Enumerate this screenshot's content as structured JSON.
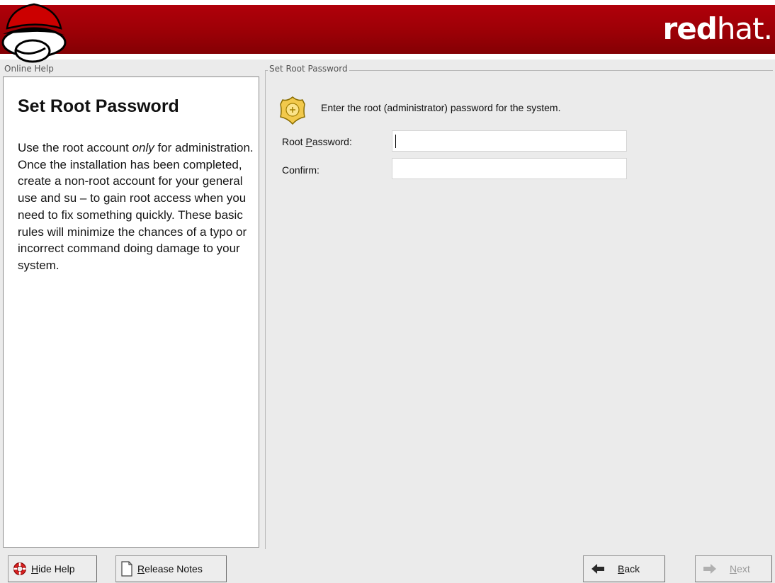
{
  "brand": {
    "bold": "red",
    "light": "hat."
  },
  "help": {
    "frame_label": "Online Help",
    "title": "Set Root Password",
    "body_before": "Use the root account ",
    "body_emph": "only",
    "body_after": " for administration. Once the installation has been completed, create a non-root account for your general use and su  – to gain root access when you need to fix something quickly. These basic rules will minimize the chances of a typo or incorrect command doing damage to your system."
  },
  "main": {
    "frame_label": "Set Root Password",
    "intro": "Enter the root (administrator) password for the system.",
    "root_password_label": "Root Password:",
    "confirm_label": "Confirm:",
    "root_password_value": "",
    "confirm_value": ""
  },
  "buttons": {
    "hide_help": "Hide Help",
    "release_notes": "Release Notes",
    "back": "Back",
    "next": "Next"
  },
  "colors": {
    "banner_red": "#9c0006",
    "background": "#ebebeb"
  }
}
